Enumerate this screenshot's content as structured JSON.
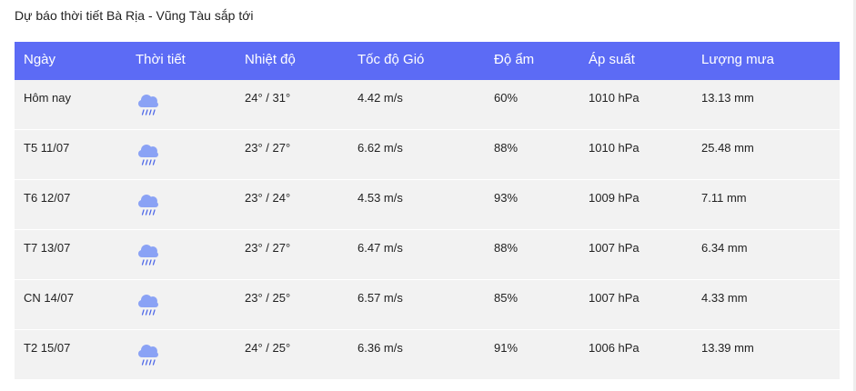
{
  "page": {
    "title": "Dự báo thời tiết Bà Rịa - Vũng Tàu sắp tới"
  },
  "table": {
    "headers": [
      "Ngày",
      "Thời tiết",
      "Nhiệt độ",
      "Tốc độ Gió",
      "Độ ẩm",
      "Áp suất",
      "Lượng mưa"
    ],
    "rows": [
      {
        "day": "Hôm nay",
        "icon": "rain-cloud-icon",
        "temp": "24° / 31°",
        "wind": "4.42 m/s",
        "humidity": "60%",
        "pressure": "1010 hPa",
        "rain": "13.13 mm"
      },
      {
        "day": "T5 11/07",
        "icon": "rain-cloud-icon",
        "temp": "23° / 27°",
        "wind": "6.62 m/s",
        "humidity": "88%",
        "pressure": "1010 hPa",
        "rain": "25.48 mm"
      },
      {
        "day": "T6 12/07",
        "icon": "rain-cloud-icon",
        "temp": "23° / 24°",
        "wind": "4.53 m/s",
        "humidity": "93%",
        "pressure": "1009 hPa",
        "rain": "7.11 mm"
      },
      {
        "day": "T7 13/07",
        "icon": "rain-cloud-icon",
        "temp": "23° / 27°",
        "wind": "6.47 m/s",
        "humidity": "88%",
        "pressure": "1007 hPa",
        "rain": "6.34 mm"
      },
      {
        "day": "CN 14/07",
        "icon": "rain-cloud-icon",
        "temp": "23° / 25°",
        "wind": "6.57 m/s",
        "humidity": "85%",
        "pressure": "1007 hPa",
        "rain": "4.33 mm"
      },
      {
        "day": "T2 15/07",
        "icon": "rain-cloud-icon",
        "temp": "24° / 25°",
        "wind": "6.36 m/s",
        "humidity": "91%",
        "pressure": "1006 hPa",
        "rain": "13.39 mm"
      }
    ]
  },
  "colors": {
    "header_bg": "#5c6bf5",
    "row_bg": "#f2f2f2",
    "cloud": "#8aa2f5",
    "rain": "#4a64e8"
  }
}
